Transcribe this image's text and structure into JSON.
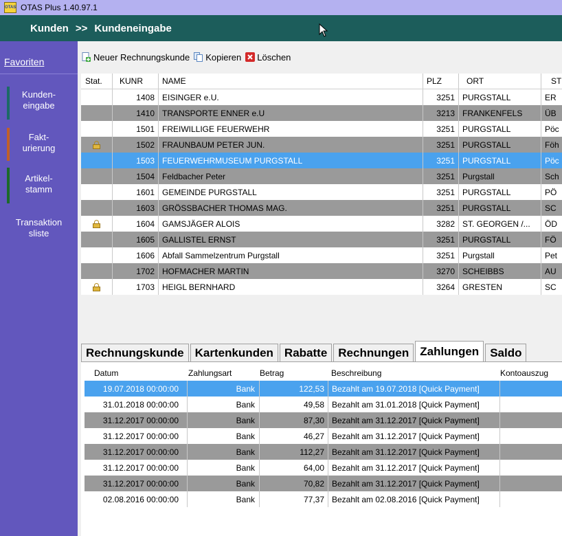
{
  "window": {
    "title": "OTAS Plus 1.40.97.1",
    "icon": "otas-app-icon",
    "icon_text": "OTAS"
  },
  "header": {
    "crumb1": "Kunden",
    "separator": ">>",
    "crumb2": "Kundeneingabe"
  },
  "sidebar": {
    "favorites": "Favoriten",
    "items": [
      {
        "line1": "Kunden-",
        "line2": "eingabe",
        "accent": "#1c6a66"
      },
      {
        "line1": "Fakt-",
        "line2": "urierung",
        "accent": "#c0602a"
      },
      {
        "line1": "Artikel-",
        "line2": "stamm",
        "accent": "#1c6a2a"
      },
      {
        "line1": "Transaktion",
        "line2": "sliste",
        "accent": ""
      }
    ]
  },
  "toolbar": {
    "new_label": "Neuer Rechnungskunde",
    "copy_label": "Kopieren",
    "delete_label": "Löschen"
  },
  "customers": {
    "columns": [
      "Stat.",
      "KUNR",
      "NAME",
      "PLZ",
      "ORT",
      "ST"
    ],
    "rows": [
      {
        "locked": false,
        "kunr": "1408",
        "name": "EISINGER e.U.",
        "plz": "3251",
        "ort": "PURGSTALL",
        "st": "ER"
      },
      {
        "locked": false,
        "kunr": "1410",
        "name": "TRANSPORTE ENNER e.U",
        "plz": "3213",
        "ort": "FRANKENFELS",
        "st": "ÜB"
      },
      {
        "locked": false,
        "kunr": "1501",
        "name": "FREIWILLIGE FEUERWEHR",
        "plz": "3251",
        "ort": "PURGSTALL",
        "st": "Pöc"
      },
      {
        "locked": true,
        "kunr": "1502",
        "name": "FRAUNBAUM PETER JUN.",
        "plz": "3251",
        "ort": "PURGSTALL",
        "st": "Föh"
      },
      {
        "locked": false,
        "kunr": "1503",
        "name": "FEUERWEHRMUSEUM PURGSTALL",
        "plz": "3251",
        "ort": "PURGSTALL",
        "st": "Pöc",
        "selected": true
      },
      {
        "locked": false,
        "kunr": "1504",
        "name": "Feldbacher Peter",
        "plz": "3251",
        "ort": "Purgstall",
        "st": "Sch"
      },
      {
        "locked": false,
        "kunr": "1601",
        "name": "GEMEINDE PURGSTALL",
        "plz": "3251",
        "ort": "PURGSTALL",
        "st": "PÖ"
      },
      {
        "locked": false,
        "kunr": "1603",
        "name": "GRÖSSBACHER THOMAS MAG.",
        "plz": "3251",
        "ort": "PURGSTALL",
        "st": "SC"
      },
      {
        "locked": true,
        "kunr": "1604",
        "name": "GAMSJÄGER ALOIS",
        "plz": "3282",
        "ort": "ST. GEORGEN /...",
        "st": "ÖD"
      },
      {
        "locked": false,
        "kunr": "1605",
        "name": "GALLISTEL ERNST",
        "plz": "3251",
        "ort": "PURGSTALL",
        "st": "FÖ"
      },
      {
        "locked": false,
        "kunr": "1606",
        "name": "Abfall Sammelzentrum Purgstall",
        "plz": "3251",
        "ort": "Purgstall",
        "st": "Pet"
      },
      {
        "locked": false,
        "kunr": "1702",
        "name": "HOFMACHER MARTIN",
        "plz": "3270",
        "ort": "SCHEIBBS",
        "st": "AU"
      },
      {
        "locked": true,
        "kunr": "1703",
        "name": "HEIGL BERNHARD",
        "plz": "3264",
        "ort": "GRESTEN",
        "st": "SC"
      }
    ]
  },
  "tabs": [
    {
      "label": "Rechnungskunde",
      "active": false
    },
    {
      "label": "Kartenkunden",
      "active": false
    },
    {
      "label": "Rabatte",
      "active": false
    },
    {
      "label": "Rechnungen",
      "active": false
    },
    {
      "label": "Zahlungen",
      "active": true
    },
    {
      "label": "Saldo",
      "active": false
    }
  ],
  "payments": {
    "columns": [
      "Datum",
      "Zahlungsart",
      "Betrag",
      "Beschreibung",
      "Kontoauszug"
    ],
    "rows": [
      {
        "datum": "19.07.2018 00:00:00",
        "art": "Bank",
        "betrag": "122,53",
        "beschr": "Bezahlt am 19.07.2018 [Quick Payment]",
        "konto": "",
        "selected": true
      },
      {
        "datum": "31.01.2018 00:00:00",
        "art": "Bank",
        "betrag": "49,58",
        "beschr": "Bezahlt am 31.01.2018 [Quick Payment]",
        "konto": ""
      },
      {
        "datum": "31.12.2017 00:00:00",
        "art": "Bank",
        "betrag": "87,30",
        "beschr": "Bezahlt am 31.12.2017 [Quick Payment]",
        "konto": ""
      },
      {
        "datum": "31.12.2017 00:00:00",
        "art": "Bank",
        "betrag": "46,27",
        "beschr": "Bezahlt am 31.12.2017 [Quick Payment]",
        "konto": ""
      },
      {
        "datum": "31.12.2017 00:00:00",
        "art": "Bank",
        "betrag": "112,27",
        "beschr": "Bezahlt am 31.12.2017 [Quick Payment]",
        "konto": ""
      },
      {
        "datum": "31.12.2017 00:00:00",
        "art": "Bank",
        "betrag": "64,00",
        "beschr": "Bezahlt am 31.12.2017 [Quick Payment]",
        "konto": ""
      },
      {
        "datum": "31.12.2017 00:00:00",
        "art": "Bank",
        "betrag": "70,82",
        "beschr": "Bezahlt am 31.12.2017 [Quick Payment]",
        "konto": ""
      },
      {
        "datum": "02.08.2016 00:00:00",
        "art": "Bank",
        "betrag": "77,37",
        "beschr": "Bezahlt am 02.08.2016 [Quick Payment]",
        "konto": ""
      }
    ]
  },
  "colors": {
    "header_bg": "#1c5d5b",
    "sidebar_bg": "#6257bd",
    "titlebar_bg": "#b4b1f0",
    "selection": "#4aa2ee",
    "alt_row": "#9a9a9a"
  }
}
